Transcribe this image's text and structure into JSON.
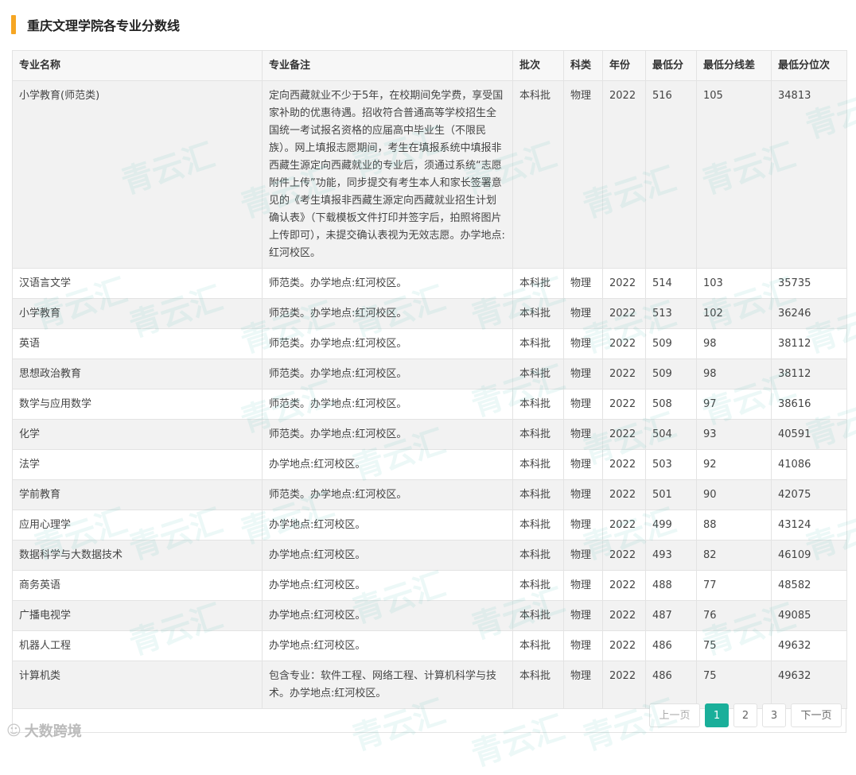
{
  "page_title": "重庆文理学院各专业分数线",
  "table": {
    "headers": [
      "专业名称",
      "专业备注",
      "批次",
      "科类",
      "年份",
      "最低分",
      "最低分线差",
      "最低分位次"
    ],
    "rows": [
      [
        "小学教育(师范类)",
        "定向西藏就业不少于5年，在校期间免学费，享受国家补助的优惠待遇。招收符合普通高等学校招生全国统一考试报名资格的应届高中毕业生（不限民族）。网上填报志愿期间，考生在填报系统中填报非西藏生源定向西藏就业的专业后，须通过系统“志愿附件上传”功能，同步提交有考生本人和家长签署意见的《考生填报非西藏生源定向西藏就业招生计划确认表》（下载模板文件打印并签字后，拍照将图片上传即可），未提交确认表视为无效志愿。办学地点:红河校区。",
        "本科批",
        "物理",
        "2022",
        "516",
        "105",
        "34813"
      ],
      [
        "汉语言文学",
        "师范类。办学地点:红河校区。",
        "本科批",
        "物理",
        "2022",
        "514",
        "103",
        "35735"
      ],
      [
        "小学教育",
        "师范类。办学地点:红河校区。",
        "本科批",
        "物理",
        "2022",
        "513",
        "102",
        "36246"
      ],
      [
        "英语",
        "师范类。办学地点:红河校区。",
        "本科批",
        "物理",
        "2022",
        "509",
        "98",
        "38112"
      ],
      [
        "思想政治教育",
        "师范类。办学地点:红河校区。",
        "本科批",
        "物理",
        "2022",
        "509",
        "98",
        "38112"
      ],
      [
        "数学与应用数学",
        "师范类。办学地点:红河校区。",
        "本科批",
        "物理",
        "2022",
        "508",
        "97",
        "38616"
      ],
      [
        "化学",
        "师范类。办学地点:红河校区。",
        "本科批",
        "物理",
        "2022",
        "504",
        "93",
        "40591"
      ],
      [
        "法学",
        "办学地点:红河校区。",
        "本科批",
        "物理",
        "2022",
        "503",
        "92",
        "41086"
      ],
      [
        "学前教育",
        "师范类。办学地点:红河校区。",
        "本科批",
        "物理",
        "2022",
        "501",
        "90",
        "42075"
      ],
      [
        "应用心理学",
        "办学地点:红河校区。",
        "本科批",
        "物理",
        "2022",
        "499",
        "88",
        "43124"
      ],
      [
        "数据科学与大数据技术",
        "办学地点:红河校区。",
        "本科批",
        "物理",
        "2022",
        "493",
        "82",
        "46109"
      ],
      [
        "商务英语",
        "办学地点:红河校区。",
        "本科批",
        "物理",
        "2022",
        "488",
        "77",
        "48582"
      ],
      [
        "广播电视学",
        "办学地点:红河校区。",
        "本科批",
        "物理",
        "2022",
        "487",
        "76",
        "49085"
      ],
      [
        "机器人工程",
        "办学地点:红河校区。",
        "本科批",
        "物理",
        "2022",
        "486",
        "75",
        "49632"
      ],
      [
        "计算机类",
        "包含专业：软件工程、网络工程、计算机科学与技术。办学地点:红河校区。",
        "本科批",
        "物理",
        "2022",
        "486",
        "75",
        "49632"
      ]
    ]
  },
  "pagination": {
    "prev": "上一页",
    "pages": [
      "1",
      "2",
      "3"
    ],
    "current": "1",
    "next": "下一页"
  },
  "watermark_text": "青云汇",
  "brand": {
    "icon": "weibo-icon",
    "text": "大数跨境"
  },
  "colors": {
    "accent": "#f6a623",
    "active_page": "#1aaf9a"
  }
}
